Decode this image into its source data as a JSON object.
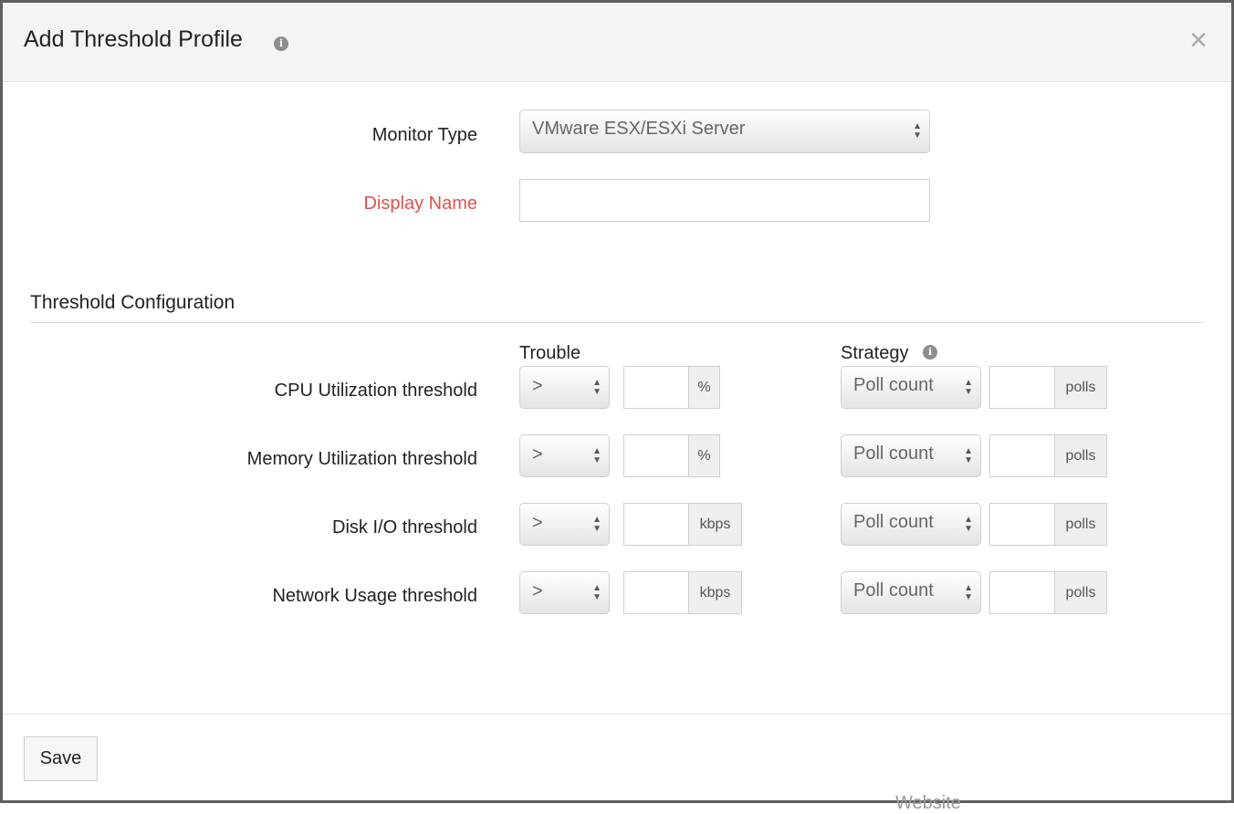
{
  "dialog": {
    "title": "Add Threshold Profile",
    "close_symbol": "×",
    "info_symbol": "i"
  },
  "form": {
    "monitor_type": {
      "label": "Monitor Type",
      "value": "VMware ESX/ESXi Server"
    },
    "display_name": {
      "label": "Display Name",
      "value": "",
      "required": true
    }
  },
  "threshold": {
    "section_title": "Threshold Configuration",
    "col_trouble": "Trouble",
    "col_strategy": "Strategy",
    "rows": [
      {
        "label": "CPU Utilization threshold",
        "operator": ">",
        "value": "",
        "unit": "%",
        "strategy": "Poll count",
        "strategy_value": "",
        "strategy_unit": "polls"
      },
      {
        "label": "Memory Utilization threshold",
        "operator": ">",
        "value": "",
        "unit": "%",
        "strategy": "Poll count",
        "strategy_value": "",
        "strategy_unit": "polls"
      },
      {
        "label": "Disk I/O threshold",
        "operator": ">",
        "value": "",
        "unit": "kbps",
        "strategy": "Poll count",
        "strategy_value": "",
        "strategy_unit": "polls"
      },
      {
        "label": "Network Usage threshold",
        "operator": ">",
        "value": "",
        "unit": "kbps",
        "strategy": "Poll count",
        "strategy_value": "",
        "strategy_unit": "polls"
      }
    ]
  },
  "footer": {
    "save_label": "Save"
  },
  "background": {
    "peek_text": "Website"
  },
  "colors": {
    "required": "#e0504a",
    "border": "#5e5e5e",
    "header_bg": "#f4f4f4"
  },
  "icons": {
    "title_info": "info-icon",
    "strategy_info": "info-icon",
    "close": "close-icon",
    "select_arrows": "updown-arrows-icon"
  }
}
